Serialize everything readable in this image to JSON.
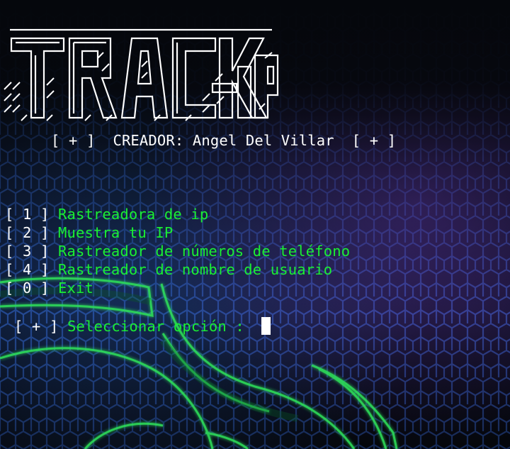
{
  "banner": {
    "text": "TRACK-IP"
  },
  "creator": {
    "left_tag": "[ + ]",
    "label": "CREADOR: Angel Del Villar",
    "right_tag": "[ + ]"
  },
  "menu": {
    "items": [
      {
        "key": "[ 1 ]",
        "label": "Rastreadora de ip"
      },
      {
        "key": "[ 2 ]",
        "label": "Muestra tu IP"
      },
      {
        "key": "[ 3 ]",
        "label": "Rastreador de números de teléfono"
      },
      {
        "key": "[ 4 ]",
        "label": "Rastreador de nombre de usuario"
      },
      {
        "key": "[ 0 ]",
        "label": "Exit"
      }
    ]
  },
  "prompt": {
    "tag": "[ + ]",
    "text": "Seleccionar opción :"
  },
  "colors": {
    "accent_green": "#1aef33",
    "text_white": "#ffffff",
    "background": "#05070c",
    "hex_grid_blue": "#2a54b4",
    "hex_grid_purple": "#6a3ec8",
    "logo_glow_green": "#2fe05a"
  }
}
